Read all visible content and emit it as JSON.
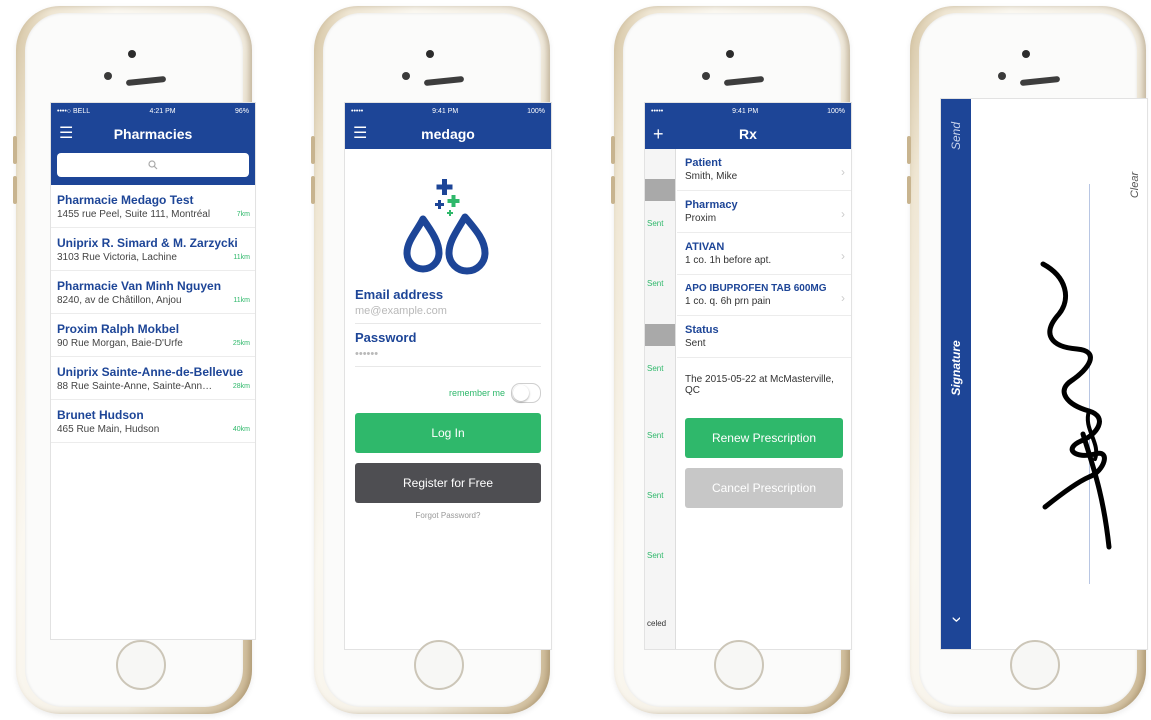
{
  "phone1": {
    "status": {
      "carrier": "••••○ BELL",
      "time": "4:21 PM",
      "battery": "96%"
    },
    "title": "Pharmacies",
    "search_placeholder": "",
    "pharmacies": [
      {
        "name": "Pharmacie Medago Test",
        "address": "1455 rue Peel, Suite 111, Montréal",
        "distance": "7km"
      },
      {
        "name": "Uniprix R. Simard & M. Zarzycki",
        "address": "3103 Rue Victoria, Lachine",
        "distance": "11km"
      },
      {
        "name": "Pharmacie Van Minh Nguyen",
        "address": "8240, av de Châtillon, Anjou",
        "distance": "11km"
      },
      {
        "name": "Proxim Ralph Mokbel",
        "address": "90 Rue Morgan, Baie-D'Urfe",
        "distance": "25km"
      },
      {
        "name": "Uniprix Sainte-Anne-de-Bellevue",
        "address": "88 Rue Sainte-Anne, Sainte-Anne-de-Bell...",
        "distance": "28km"
      },
      {
        "name": "Brunet Hudson",
        "address": "465 Rue Main, Hudson",
        "distance": "40km"
      }
    ]
  },
  "phone2": {
    "status": {
      "carrier": "•••••",
      "time": "9:41 PM",
      "battery": "100%"
    },
    "title": "medago",
    "email_label": "Email address",
    "email_placeholder": "me@example.com",
    "password_label": "Password",
    "password_placeholder": "••••••",
    "remember_label": "remember me",
    "login_label": "Log In",
    "register_label": "Register for Free",
    "forgot_label": "Forgot Password?"
  },
  "phone3": {
    "status": {
      "carrier": "•••••",
      "time": "9:41 PM",
      "battery": "100%"
    },
    "title": "Rx",
    "add_symbol": "+",
    "strip_labels": [
      "Sent",
      "Sent",
      "Sent",
      "Sent",
      "Sent",
      "Sent",
      "celed"
    ],
    "rows": [
      {
        "heading": "Patient",
        "value": "Smith, Mike",
        "chevron": true
      },
      {
        "heading": "Pharmacy",
        "value": "Proxim",
        "chevron": true
      },
      {
        "heading": "ATIVAN",
        "value": "1 co. 1h before apt.",
        "chevron": true
      },
      {
        "heading": "APO IBUPROFEN TAB 600MG",
        "value": "1 co. q. 6h prn pain",
        "chevron": true
      },
      {
        "heading": "Status",
        "value": "Sent",
        "chevron": false
      }
    ],
    "note": "The 2015-05-22 at McMasterville, QC",
    "renew_label": "Renew Prescription",
    "cancel_label": "Cancel Prescription"
  },
  "phone4": {
    "send_label": "Send",
    "signature_label": "Signature",
    "clear_label": "Clear",
    "chevron": "‹"
  },
  "colors": {
    "brand_blue": "#1d4597",
    "accent_green": "#2fb86b",
    "dark_button": "#4e4e52"
  }
}
